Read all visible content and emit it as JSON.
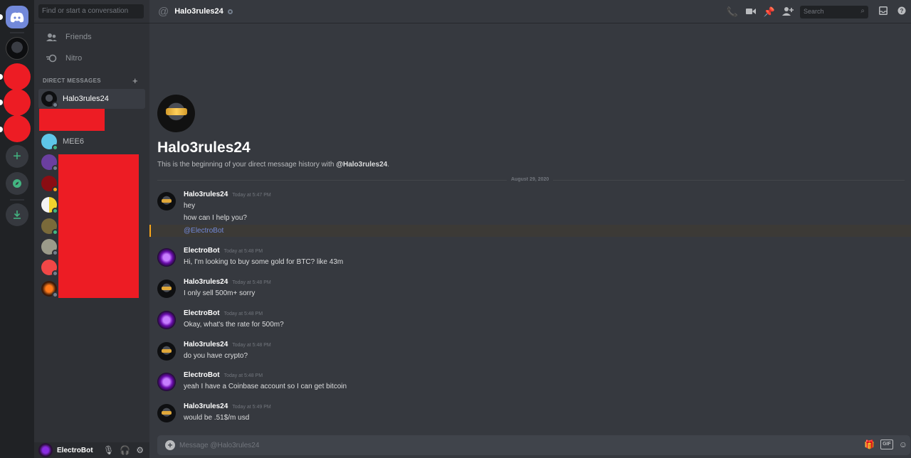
{
  "sidebar": {
    "search_placeholder": "Find or start a conversation",
    "nav": [
      {
        "label": "Friends",
        "icon": "friends-icon"
      },
      {
        "label": "Nitro",
        "icon": "nitro-icon"
      }
    ],
    "dm_header": "DIRECT MESSAGES",
    "dms": [
      {
        "name": "Halo3rules24",
        "status": "offline",
        "active": true
      },
      {
        "name": "MEE6",
        "status": "online"
      }
    ]
  },
  "user_panel": {
    "name": "ElectroBot"
  },
  "header": {
    "channel": "Halo3rules24",
    "search_placeholder": "Search"
  },
  "intro": {
    "title": "Halo3rules24",
    "text_prefix": "This is the beginning of your direct message history with ",
    "mention": "@Halo3rules24",
    "text_suffix": "."
  },
  "date_divider": "August 29, 2020",
  "messages": [
    {
      "author": "Halo3rules24",
      "time": "Today at 5:47 PM",
      "lines": [
        "hey",
        "how can I help you?"
      ],
      "mention": "@ElectroBot"
    },
    {
      "author": "ElectroBot",
      "time": "Today at 5:48 PM",
      "lines": [
        "Hi, I'm looking to buy some gold for BTC? like 43m"
      ]
    },
    {
      "author": "Halo3rules24",
      "time": "Today at 5:48 PM",
      "lines": [
        "I only sell 500m+ sorry"
      ]
    },
    {
      "author": "ElectroBot",
      "time": "Today at 5:48 PM",
      "lines": [
        "Okay, what's the rate for 500m?"
      ]
    },
    {
      "author": "Halo3rules24",
      "time": "Today at 5:48 PM",
      "lines": [
        "do you have crypto?"
      ]
    },
    {
      "author": "ElectroBot",
      "time": "Today at 5:48 PM",
      "lines": [
        "yeah I have a Coinbase account so I can get bitcoin"
      ]
    },
    {
      "author": "Halo3rules24",
      "time": "Today at 5:49 PM",
      "lines": [
        "would be .51$/m usd"
      ]
    }
  ],
  "input": {
    "placeholder": "Message @Halo3rules24"
  },
  "colors": {
    "blurple": "#7289da",
    "online": "#43b581",
    "idle": "#faa61a",
    "redaction": "#ed1c24"
  }
}
